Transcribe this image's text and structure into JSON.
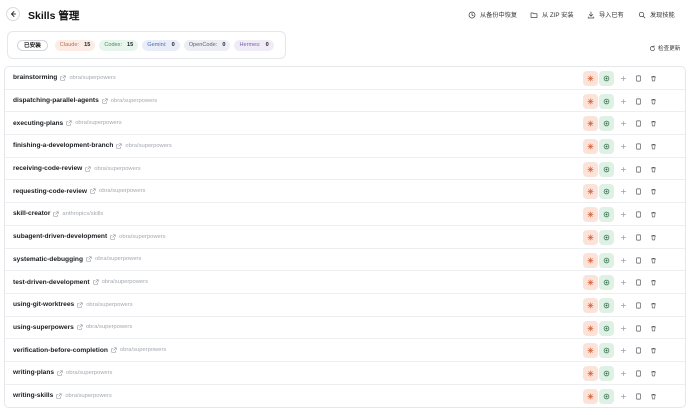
{
  "header": {
    "title": "Skills 管理",
    "restore_label": "从备份中恢复",
    "zip_label": "从 ZIP 安装",
    "import_label": "导入已有",
    "discover_label": "发现技能"
  },
  "filters": {
    "all_label": "已安装",
    "apps": [
      {
        "key": "claude",
        "label": "Claude:",
        "count": "15"
      },
      {
        "key": "codex",
        "label": "Codex:",
        "count": "15"
      },
      {
        "key": "gemini",
        "label": "Gemini:",
        "count": "0"
      },
      {
        "key": "opencode",
        "label": "OpenCode:",
        "count": "0"
      },
      {
        "key": "hermes",
        "label": "Hermes:",
        "count": "0"
      }
    ]
  },
  "refresh_label": "检查更新",
  "skills": [
    {
      "name": "brainstorming",
      "repo": "obra/superpowers"
    },
    {
      "name": "dispatching-parallel-agents",
      "repo": "obra/superpowers"
    },
    {
      "name": "executing-plans",
      "repo": "obra/superpowers"
    },
    {
      "name": "finishing-a-development-branch",
      "repo": "obra/superpowers"
    },
    {
      "name": "receiving-code-review",
      "repo": "obra/superpowers"
    },
    {
      "name": "requesting-code-review",
      "repo": "obra/superpowers"
    },
    {
      "name": "skill-creator",
      "repo": "anthropics/skills"
    },
    {
      "name": "subagent-driven-development",
      "repo": "obra/superpowers"
    },
    {
      "name": "systematic-debugging",
      "repo": "obra/superpowers"
    },
    {
      "name": "test-driven-development",
      "repo": "obra/superpowers"
    },
    {
      "name": "using-git-worktrees",
      "repo": "obra/superpowers"
    },
    {
      "name": "using-superpowers",
      "repo": "obra/superpowers"
    },
    {
      "name": "verification-before-completion",
      "repo": "obra/superpowers"
    },
    {
      "name": "writing-plans",
      "repo": "obra/superpowers"
    },
    {
      "name": "writing-skills",
      "repo": "obra/superpowers"
    }
  ],
  "colors": {
    "claude": "#d9653f",
    "codex": "#3f8f5c",
    "muted_icon": "#9aa0a8"
  }
}
